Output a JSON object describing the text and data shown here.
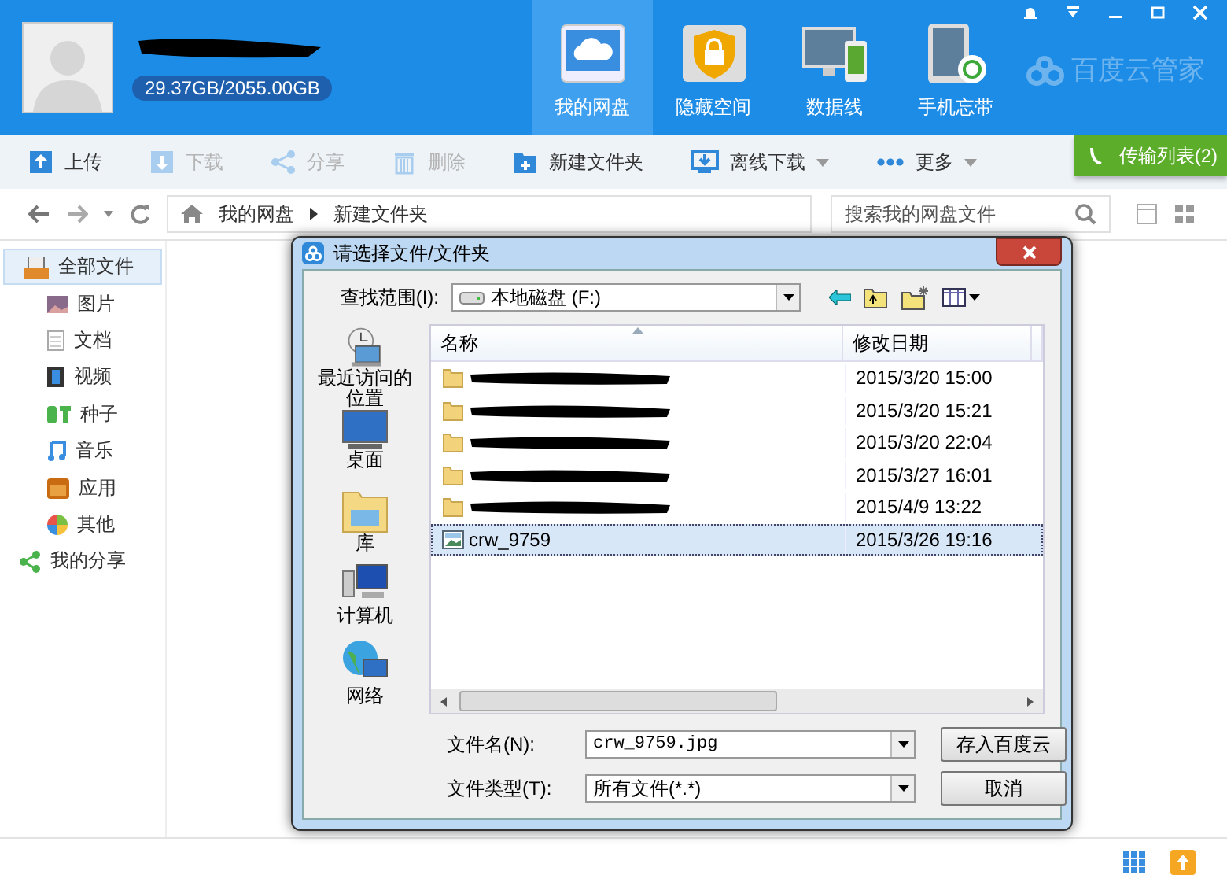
{
  "app": {
    "storage": "29.37GB/2055.00GB",
    "logo": "百度云管家"
  },
  "nav_tabs": [
    {
      "label": "我的网盘",
      "selected": true
    },
    {
      "label": "隐藏空间",
      "selected": false
    },
    {
      "label": "数据线",
      "selected": false
    },
    {
      "label": "手机忘带",
      "selected": false
    }
  ],
  "toolbar": [
    {
      "label": "上传",
      "disabled": false
    },
    {
      "label": "下载",
      "disabled": true
    },
    {
      "label": "分享",
      "disabled": true
    },
    {
      "label": "删除",
      "disabled": true
    },
    {
      "label": "新建文件夹",
      "disabled": false
    },
    {
      "label": "离线下载",
      "disabled": false,
      "dropdown": true
    },
    {
      "label": "更多",
      "disabled": false,
      "dropdown": true
    }
  ],
  "transfer_button": "传输列表(2)",
  "breadcrumb": [
    "我的网盘",
    "新建文件夹"
  ],
  "search": {
    "placeholder": "搜索我的网盘文件"
  },
  "sidebar": {
    "items": [
      {
        "label": "全部文件",
        "selected": true,
        "children": [
          {
            "label": "图片",
            "selected": false
          },
          {
            "label": "文档",
            "selected": false
          },
          {
            "label": "视频",
            "selected": false
          },
          {
            "label": "种子",
            "selected": false
          },
          {
            "label": "音乐",
            "selected": false
          },
          {
            "label": "应用",
            "selected": false
          },
          {
            "label": "其他",
            "selected": false
          }
        ]
      },
      {
        "label": "我的分享",
        "selected": false
      }
    ]
  },
  "dialog": {
    "title": "请选择文件/文件夹",
    "look_in_label": "查找范围(I):",
    "look_in": "本地磁盘 (F:)",
    "places": [
      "最近访问的位置",
      "桌面",
      "库",
      "计算机",
      "网络"
    ],
    "columns": [
      "名称",
      "修改日期"
    ],
    "files": [
      {
        "kind": "folder",
        "redacted": true,
        "modified": "2015/3/20 15:00",
        "selected": false
      },
      {
        "kind": "folder",
        "redacted": true,
        "modified": "2015/3/20 15:21",
        "selected": false
      },
      {
        "kind": "folder",
        "redacted": true,
        "modified": "2015/3/20 22:04",
        "selected": false
      },
      {
        "kind": "folder",
        "redacted": true,
        "modified": "2015/3/27 16:01",
        "selected": false
      },
      {
        "kind": "folder",
        "redacted": true,
        "modified": "2015/4/9 13:22",
        "selected": false
      },
      {
        "kind": "image",
        "name": "crw_9759",
        "modified": "2015/3/26 19:16",
        "selected": true
      }
    ],
    "file_name_label": "文件名(N):",
    "file_name": "crw_9759.jpg",
    "file_type_label": "文件类型(T):",
    "file_type": "所有文件(*.*)",
    "buttons": [
      "存入百度云",
      "取消"
    ]
  }
}
